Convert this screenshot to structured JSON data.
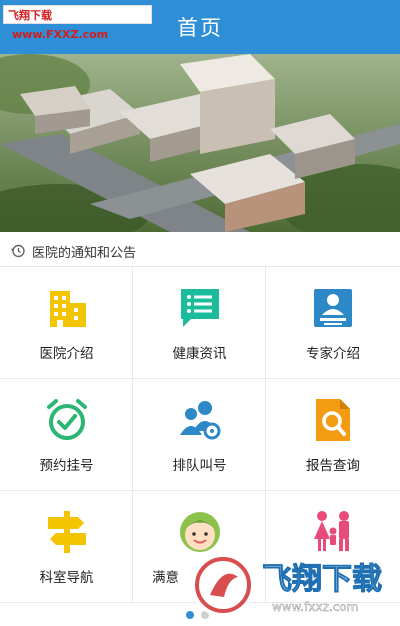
{
  "status_badge": {
    "brand": "飞翔下载",
    "url": "www.FXXZ.com"
  },
  "header": {
    "title": "首页"
  },
  "notice": {
    "label": "医院的通知和公告"
  },
  "menu": [
    {
      "label": "医院介绍",
      "icon": "building-icon"
    },
    {
      "label": "健康资讯",
      "icon": "news-list-icon"
    },
    {
      "label": "专家介绍",
      "icon": "doctor-card-icon"
    },
    {
      "label": "预约挂号",
      "icon": "alarm-clock-icon"
    },
    {
      "label": "排队叫号",
      "icon": "queue-people-icon"
    },
    {
      "label": "报告查询",
      "icon": "report-search-icon"
    },
    {
      "label": "科室导航",
      "icon": "signpost-icon"
    },
    {
      "label": "满意",
      "icon": "smiley-face-icon"
    },
    {
      "label": "",
      "icon": "family-icon"
    }
  ],
  "carousel": {
    "pages": 2,
    "active": 1
  },
  "watermark": {
    "brand": "飞翔下载",
    "url": "www.fxxz.com"
  },
  "colors": {
    "header": "#2f8fd6",
    "accent_yellow": "#f5c400",
    "accent_teal": "#1abc9c",
    "accent_blue": "#2d88c8",
    "accent_green": "#2bb673",
    "accent_orange": "#f39c12",
    "accent_pink": "#e84a7a"
  }
}
